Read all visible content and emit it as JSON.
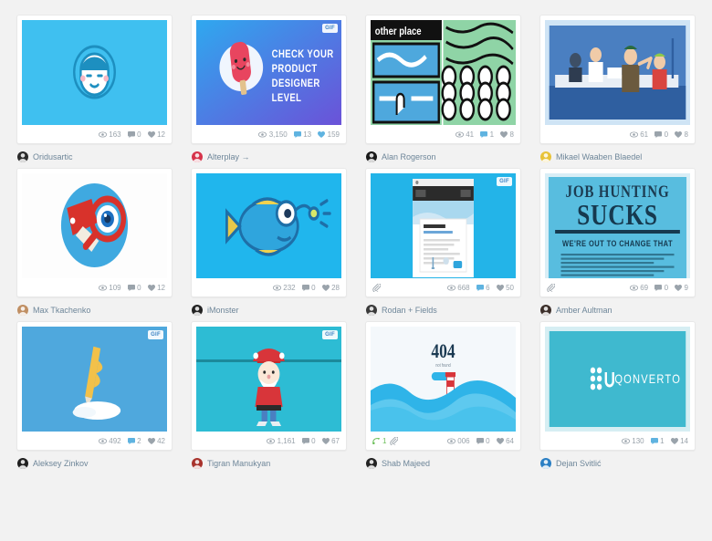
{
  "page": {
    "background_color": "#f2f2f2",
    "card_background": "#ffffff",
    "stat_text_color": "#9aa3ab",
    "author_text_color": "#6e8699",
    "accent_color": "#29a9e0"
  },
  "icons": {
    "views": "eye-icon",
    "comments": "comment-icon",
    "likes": "heart-icon",
    "attachment": "paperclip-icon",
    "rebound": "rebound-icon",
    "gif_badge": "gif-badge"
  },
  "shots": [
    {
      "id": "shot-1",
      "author": "Oridusartic",
      "author_suffix": "",
      "avatar_color": "#2b2b2b",
      "views": "163",
      "comments": "0",
      "likes": "12",
      "gif": false,
      "attachment": false,
      "rebound": "",
      "thumb_bg": "#3fc0f0",
      "thumb_kind": "face",
      "thumb_title": ""
    },
    {
      "id": "shot-2",
      "author": "Alterplay",
      "author_suffix": "→",
      "avatar_color": "#d6334a",
      "views": "3,150",
      "comments": "13",
      "likes": "159",
      "gif": true,
      "attachment": false,
      "rebound": "",
      "thumb_bg": "#2f7fe0",
      "thumb_kind": "popsicle",
      "thumb_title": "CHECK YOUR PRODUCT DESIGNER LEVEL"
    },
    {
      "id": "shot-3",
      "author": "Alan Rogerson",
      "author_suffix": "",
      "avatar_color": "#1a1a1a",
      "views": "41",
      "comments": "1",
      "likes": "8",
      "gif": false,
      "attachment": false,
      "rebound": "",
      "thumb_bg": "#ffffff",
      "thumb_kind": "illustration",
      "thumb_title": "other place"
    },
    {
      "id": "shot-4",
      "author": "Mikael Waaben Blaedel",
      "author_suffix": "",
      "avatar_color": "#e8c33a",
      "views": "61",
      "comments": "0",
      "likes": "8",
      "gif": false,
      "attachment": false,
      "rebound": "",
      "thumb_bg": "#cfe4f5",
      "thumb_kind": "office",
      "thumb_title": ""
    },
    {
      "id": "shot-5",
      "author": "Max Tkachenko",
      "author_suffix": "",
      "avatar_color": "#c08f63",
      "views": "109",
      "comments": "0",
      "likes": "12",
      "gif": false,
      "attachment": false,
      "rebound": "",
      "thumb_bg": "#fdfdfd",
      "thumb_kind": "magnifier",
      "thumb_title": ""
    },
    {
      "id": "shot-6",
      "author": "iMonster",
      "author_suffix": "",
      "avatar_color": "#222222",
      "views": "232",
      "comments": "0",
      "likes": "28",
      "gif": false,
      "attachment": false,
      "rebound": "",
      "thumb_bg": "#20b6ed",
      "thumb_kind": "fish",
      "thumb_title": ""
    },
    {
      "id": "shot-7",
      "author": "Rodan + Fields",
      "author_suffix": "",
      "avatar_color": "#3a3a3a",
      "views": "668",
      "comments": "6",
      "likes": "50",
      "gif": true,
      "attachment": true,
      "rebound": "",
      "thumb_bg": "#23b4e8",
      "thumb_kind": "browser",
      "thumb_title": ""
    },
    {
      "id": "shot-8",
      "author": "Amber Aultman",
      "author_suffix": "",
      "avatar_color": "#3c2f2a",
      "views": "69",
      "comments": "0",
      "likes": "9",
      "gif": false,
      "attachment": true,
      "rebound": "",
      "thumb_bg": "#49b6dd",
      "thumb_kind": "poster",
      "thumb_title": "JOB HUNTING SUCKS WE'RE OUT TO CHANGE THAT"
    },
    {
      "id": "shot-9",
      "author": "Aleksey Zinkov",
      "author_suffix": "",
      "avatar_color": "#1f1f1f",
      "views": "492",
      "comments": "2",
      "likes": "42",
      "gif": true,
      "attachment": false,
      "rebound": "",
      "thumb_bg": "#4fa8dd",
      "thumb_kind": "pencil",
      "thumb_title": ""
    },
    {
      "id": "shot-10",
      "author": "Tigran Manukyan",
      "author_suffix": "",
      "avatar_color": "#a8322c",
      "views": "1,161",
      "comments": "0",
      "likes": "67",
      "gif": true,
      "attachment": false,
      "rebound": "",
      "thumb_bg": "#2dbcd4",
      "thumb_kind": "santa",
      "thumb_title": ""
    },
    {
      "id": "shot-11",
      "author": "Shab Majeed",
      "author_suffix": "",
      "avatar_color": "#232323",
      "views": "006",
      "comments": "0",
      "likes": "64",
      "gif": false,
      "attachment": true,
      "rebound": "1",
      "thumb_bg": "#f4f8fb",
      "thumb_kind": "waves404",
      "thumb_title": "404"
    },
    {
      "id": "shot-12",
      "author": "Dejan Svitlić",
      "author_suffix": "",
      "avatar_color": "#2a7fc4",
      "views": "130",
      "comments": "1",
      "likes": "14",
      "gif": false,
      "attachment": false,
      "rebound": "",
      "thumb_bg": "#3fb9cf",
      "thumb_kind": "qonverto",
      "thumb_title": "QONVERTO"
    }
  ]
}
